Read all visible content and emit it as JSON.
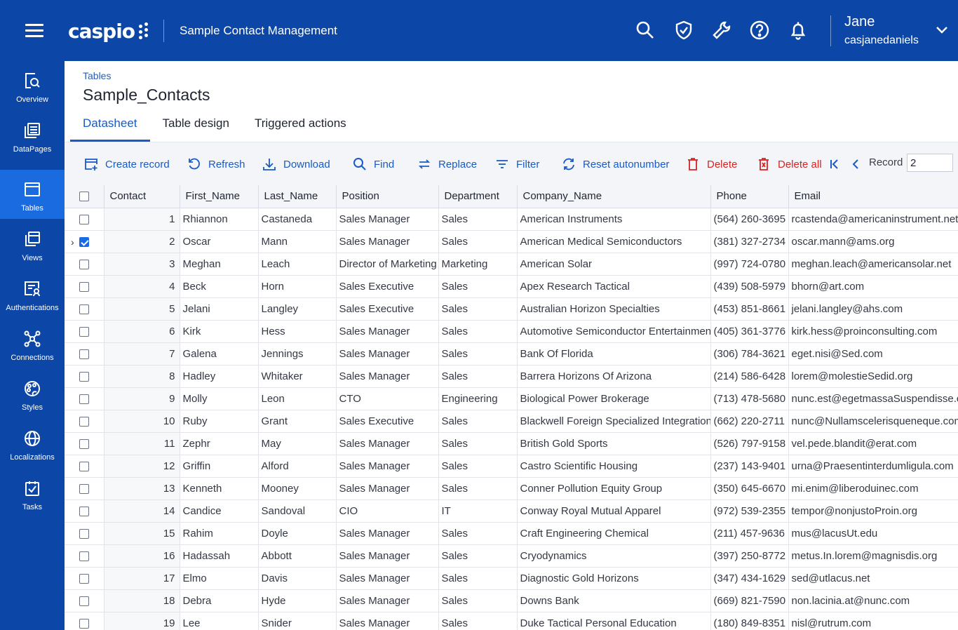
{
  "header": {
    "logo_text": "caspio",
    "app_title": "Sample Contact Management",
    "user_name": "Jane",
    "user_id": "casjanedaniels"
  },
  "colors": {
    "brand": "#0c46a6",
    "active": "#1a6be0",
    "link": "#1a5ac4",
    "danger": "#d42424"
  },
  "sidebar": {
    "items": [
      {
        "label": "Overview",
        "icon": "overview-icon"
      },
      {
        "label": "DataPages",
        "icon": "datapages-icon"
      },
      {
        "label": "Tables",
        "icon": "tables-icon"
      },
      {
        "label": "Views",
        "icon": "views-icon"
      },
      {
        "label": "Authentications",
        "icon": "authentications-icon"
      },
      {
        "label": "Connections",
        "icon": "connections-icon"
      },
      {
        "label": "Styles",
        "icon": "styles-icon"
      },
      {
        "label": "Localizations",
        "icon": "globe-icon"
      },
      {
        "label": "Tasks",
        "icon": "tasks-icon"
      }
    ]
  },
  "page": {
    "breadcrumb": "Tables",
    "title": "Sample_Contacts",
    "tabs": [
      {
        "label": "Datasheet"
      },
      {
        "label": "Table design"
      },
      {
        "label": "Triggered actions"
      }
    ]
  },
  "toolbar": {
    "create": "Create record",
    "refresh": "Refresh",
    "download": "Download",
    "find": "Find",
    "replace": "Replace",
    "filter": "Filter",
    "reset": "Reset autonumber",
    "delete": "Delete",
    "delete_all": "Delete all",
    "record_label": "Record",
    "record_value": "2"
  },
  "table": {
    "columns": [
      "Contact",
      "First_Name",
      "Last_Name",
      "Position",
      "Department",
      "Company_Name",
      "Phone",
      "Email"
    ],
    "rows": [
      {
        "n": "1",
        "first": "Rhiannon",
        "last": "Castaneda",
        "pos": "Sales Manager",
        "dept": "Sales",
        "company": "American Instruments",
        "phone": "(564) 260-3695",
        "email": "rcastenda@americaninstrument.net"
      },
      {
        "n": "2",
        "first": "Oscar",
        "last": "Mann",
        "pos": "Sales Manager",
        "dept": "Sales",
        "company": "American Medical Semiconductors",
        "phone": "(381) 327-2734",
        "email": "oscar.mann@ams.org"
      },
      {
        "n": "3",
        "first": "Meghan",
        "last": "Leach",
        "pos": "Director of Marketing",
        "dept": "Marketing",
        "company": "American Solar",
        "phone": "(997) 724-0780",
        "email": "meghan.leach@americansolar.net"
      },
      {
        "n": "4",
        "first": "Beck",
        "last": "Horn",
        "pos": "Sales Executive",
        "dept": "Sales",
        "company": "Apex Research Tactical",
        "phone": "(439) 508-5979",
        "email": "bhorn@art.com"
      },
      {
        "n": "5",
        "first": "Jelani",
        "last": "Langley",
        "pos": "Sales Executive",
        "dept": "Sales",
        "company": "Australian Horizon Specialties",
        "phone": "(453) 851-8661",
        "email": "jelani.langley@ahs.com"
      },
      {
        "n": "6",
        "first": "Kirk",
        "last": "Hess",
        "pos": "Sales Manager",
        "dept": "Sales",
        "company": "Automotive Semiconductor Entertainment",
        "phone": "(405) 361-3776",
        "email": "kirk.hess@proinconsulting.com"
      },
      {
        "n": "7",
        "first": "Galena",
        "last": "Jennings",
        "pos": "Sales Manager",
        "dept": "Sales",
        "company": "Bank Of Florida",
        "phone": "(306) 784-3621",
        "email": "eget.nisi@Sed.com"
      },
      {
        "n": "8",
        "first": "Hadley",
        "last": "Whitaker",
        "pos": "Sales Manager",
        "dept": "Sales",
        "company": "Barrera Horizons Of Arizona",
        "phone": "(214) 586-6428",
        "email": "lorem@molestieSedid.org"
      },
      {
        "n": "9",
        "first": "Molly",
        "last": "Leon",
        "pos": "CTO",
        "dept": "Engineering",
        "company": "Biological Power Brokerage",
        "phone": "(713) 478-5680",
        "email": "nunc.est@egetmassaSuspendisse.com"
      },
      {
        "n": "10",
        "first": "Ruby",
        "last": "Grant",
        "pos": "Sales Executive",
        "dept": "Sales",
        "company": "Blackwell Foreign Specialized Integration",
        "phone": "(662) 220-2711",
        "email": "nunc@Nullamscelerisqueneque.com"
      },
      {
        "n": "11",
        "first": "Zephr",
        "last": "May",
        "pos": "Sales Manager",
        "dept": "Sales",
        "company": "British Gold Sports",
        "phone": "(526) 797-9158",
        "email": "vel.pede.blandit@erat.com"
      },
      {
        "n": "12",
        "first": "Griffin",
        "last": "Alford",
        "pos": "Sales Manager",
        "dept": "Sales",
        "company": "Castro Scientific Housing",
        "phone": "(237) 143-9401",
        "email": "urna@Praesentinterdumligula.com"
      },
      {
        "n": "13",
        "first": "Kenneth",
        "last": "Mooney",
        "pos": "Sales Manager",
        "dept": "Sales",
        "company": "Conner Pollution Equity Group",
        "phone": "(350) 645-6670",
        "email": "mi.enim@liberoduinec.com"
      },
      {
        "n": "14",
        "first": "Candice",
        "last": "Sandoval",
        "pos": "CIO",
        "dept": "IT",
        "company": "Conway Royal Mutual Apparel",
        "phone": "(972) 539-2355",
        "email": "tempor@nonjustoProin.org"
      },
      {
        "n": "15",
        "first": "Rahim",
        "last": "Doyle",
        "pos": "Sales Manager",
        "dept": "Sales",
        "company": "Craft Engineering Chemical",
        "phone": "(211) 457-9636",
        "email": "mus@lacusUt.edu"
      },
      {
        "n": "16",
        "first": "Hadassah",
        "last": "Abbott",
        "pos": "Sales Manager",
        "dept": "Sales",
        "company": "Cryodynamics",
        "phone": "(397) 250-8772",
        "email": "metus.In.lorem@magnisdis.org"
      },
      {
        "n": "17",
        "first": "Elmo",
        "last": "Davis",
        "pos": "Sales Manager",
        "dept": "Sales",
        "company": "Diagnostic Gold Horizons",
        "phone": "(347) 434-1629",
        "email": "sed@utlacus.net"
      },
      {
        "n": "18",
        "first": "Debra",
        "last": "Hyde",
        "pos": "Sales Manager",
        "dept": "Sales",
        "company": "Downs Bank",
        "phone": "(669) 821-7590",
        "email": "non.lacinia.at@nunc.com"
      },
      {
        "n": "19",
        "first": "Lee",
        "last": "Snider",
        "pos": "Sales Manager",
        "dept": "Sales",
        "company": "Duke Tactical Personal Education",
        "phone": "(180) 849-8351",
        "email": "nisl@rutrum.com"
      }
    ]
  }
}
